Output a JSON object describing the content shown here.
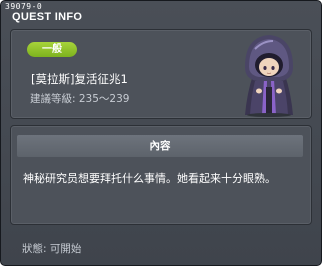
{
  "window": {
    "quest_id": "39079-0",
    "title": "QUEST INFO"
  },
  "quest": {
    "category": "一般",
    "name": "[莫拉斯]复活征兆1",
    "level_requirement": "建議等級: 235～239",
    "portrait_icon": "hooded-figure-icon"
  },
  "content": {
    "header": "內容",
    "description": "神秘研究员想要拜托什么事情。她看起来十分眼熟。"
  },
  "status": {
    "text": "狀態:  可開始"
  },
  "colors": {
    "background": "#43484f",
    "panel": "#4d525a",
    "accent_green": "#8fc22a",
    "header_bar": "#656b74"
  }
}
